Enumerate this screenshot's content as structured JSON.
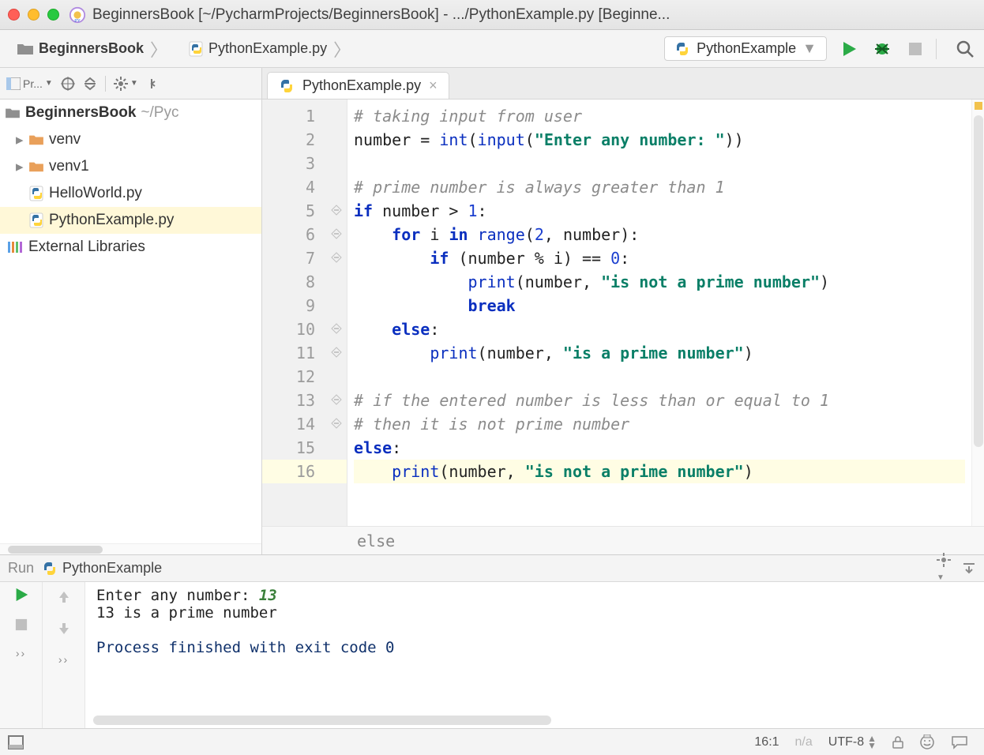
{
  "window": {
    "title": "BeginnersBook [~/PycharmProjects/BeginnersBook] - .../PythonExample.py [Beginne..."
  },
  "breadcrumb": {
    "project": "BeginnersBook",
    "file": "PythonExample.py"
  },
  "run_config": {
    "selected": "PythonExample"
  },
  "sidebar": {
    "toolbar_label": "Pr...",
    "root_name": "BeginnersBook",
    "root_path": "~/Pyc",
    "items": [
      {
        "kind": "folder",
        "label": "venv"
      },
      {
        "kind": "folder",
        "label": "venv1"
      },
      {
        "kind": "pyfile",
        "label": "HelloWorld.py"
      },
      {
        "kind": "pyfile",
        "label": "PythonExample.py",
        "selected": true
      }
    ],
    "external": "External Libraries"
  },
  "editor": {
    "tab": "PythonExample.py",
    "lines": [
      {
        "n": 1,
        "seg": [
          {
            "t": "# taking input from user",
            "c": "c-comm"
          }
        ]
      },
      {
        "n": 2,
        "seg": [
          {
            "t": "number = "
          },
          {
            "t": "int",
            "c": "c-builtin"
          },
          {
            "t": "("
          },
          {
            "t": "input",
            "c": "c-builtin"
          },
          {
            "t": "("
          },
          {
            "t": "\"Enter any number: \"",
            "c": "c-str"
          },
          {
            "t": "))"
          }
        ]
      },
      {
        "n": 3,
        "seg": [
          {
            "t": ""
          }
        ]
      },
      {
        "n": 4,
        "seg": [
          {
            "t": "# prime number is always greater than 1",
            "c": "c-comm"
          }
        ]
      },
      {
        "n": 5,
        "fold": true,
        "seg": [
          {
            "t": "if ",
            "c": "c-kw"
          },
          {
            "t": "number > "
          },
          {
            "t": "1",
            "c": "c-num"
          },
          {
            "t": ":"
          }
        ]
      },
      {
        "n": 6,
        "fold": true,
        "seg": [
          {
            "t": "    "
          },
          {
            "t": "for ",
            "c": "c-kw"
          },
          {
            "t": "i "
          },
          {
            "t": "in ",
            "c": "c-kw"
          },
          {
            "t": "range",
            "c": "c-builtin"
          },
          {
            "t": "("
          },
          {
            "t": "2",
            "c": "c-num"
          },
          {
            "t": ", number):"
          }
        ]
      },
      {
        "n": 7,
        "fold": true,
        "seg": [
          {
            "t": "        "
          },
          {
            "t": "if ",
            "c": "c-kw"
          },
          {
            "t": "(number % i) == "
          },
          {
            "t": "0",
            "c": "c-num"
          },
          {
            "t": ":"
          }
        ]
      },
      {
        "n": 8,
        "seg": [
          {
            "t": "            "
          },
          {
            "t": "print",
            "c": "c-builtin"
          },
          {
            "t": "(number, "
          },
          {
            "t": "\"is not a prime number\"",
            "c": "c-str"
          },
          {
            "t": ")"
          }
        ]
      },
      {
        "n": 9,
        "seg": [
          {
            "t": "            "
          },
          {
            "t": "break",
            "c": "c-kw"
          }
        ]
      },
      {
        "n": 10,
        "fold": true,
        "seg": [
          {
            "t": "    "
          },
          {
            "t": "else",
            "c": "c-kw"
          },
          {
            "t": ":"
          }
        ]
      },
      {
        "n": 11,
        "fold": true,
        "seg": [
          {
            "t": "        "
          },
          {
            "t": "print",
            "c": "c-builtin"
          },
          {
            "t": "(number, "
          },
          {
            "t": "\"is a prime number\"",
            "c": "c-str"
          },
          {
            "t": ")"
          }
        ]
      },
      {
        "n": 12,
        "seg": [
          {
            "t": ""
          }
        ]
      },
      {
        "n": 13,
        "fold": true,
        "seg": [
          {
            "t": "# if the entered number is less than or equal to 1",
            "c": "c-comm"
          }
        ]
      },
      {
        "n": 14,
        "fold": true,
        "seg": [
          {
            "t": "# then it is not prime number",
            "c": "c-comm"
          }
        ]
      },
      {
        "n": 15,
        "seg": [
          {
            "t": "else",
            "c": "c-kw"
          },
          {
            "t": ":"
          }
        ]
      },
      {
        "n": 16,
        "hl": true,
        "seg": [
          {
            "t": "    "
          },
          {
            "t": "print",
            "c": "c-builtin"
          },
          {
            "t": "(number, "
          },
          {
            "t": "\"is not a prime number\"",
            "c": "c-str"
          },
          {
            "t": ")"
          }
        ]
      }
    ],
    "breadcrumb_path": "else"
  },
  "run_panel": {
    "label": "Run",
    "name": "PythonExample",
    "output": {
      "prompt_text": "Enter any number: ",
      "prompt_input": "13",
      "result_line": "13 is a prime number",
      "exit_line": "Process finished with exit code 0"
    }
  },
  "statusbar": {
    "pos": "16:1",
    "sep": "n/a",
    "encoding": "UTF-8"
  }
}
